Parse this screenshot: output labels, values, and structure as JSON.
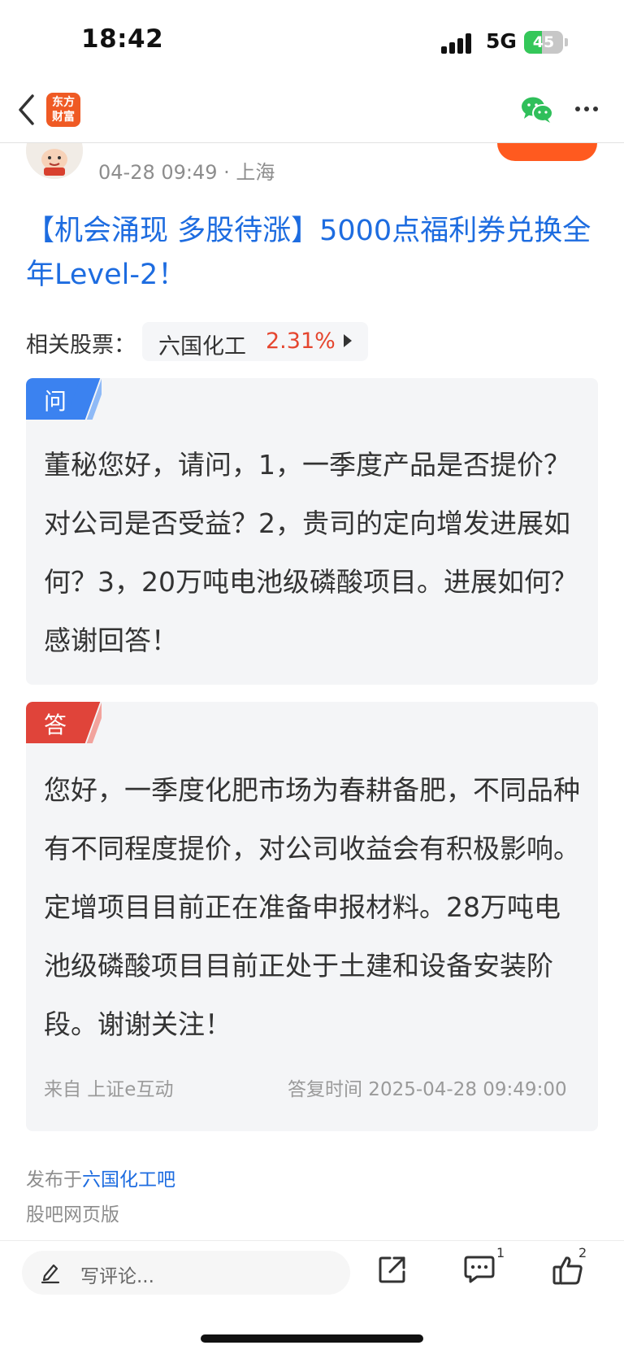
{
  "status_bar": {
    "time": "18:42",
    "network": "5G",
    "battery": "45",
    "battery_level": 0.45
  },
  "nav": {
    "logo_line1": "东方",
    "logo_line2": "财富"
  },
  "author": {
    "date": "04-28 09:49",
    "location": "· 上海"
  },
  "post": {
    "title": "【机会涌现 多股待涨】5000点福利券兑换全年Level-2！"
  },
  "related": {
    "label": "相关股票：",
    "stock_name": "六国化工",
    "stock_change": "2.31%",
    "accent_up": "#e5462f"
  },
  "question": {
    "tag": "问",
    "text": "董秘您好，请问，1，一季度产品是否提价？对公司是否受益？2，贵司的定向增发进展如何？3，20万吨电池级磷酸项目。进展如何？感谢回答！"
  },
  "answer": {
    "tag": "答",
    "text": "您好，一季度化肥市场为春耕备肥，不同品种有不同程度提价，对公司收益会有积极影响。定增项目目前正在准备申报材料。28万吨电池级磷酸项目目前正处于土建和设备安装阶段。谢谢关注！",
    "source": "来自 上证e互动",
    "reply_time": "答复时间 2025-04-28 09:49:00"
  },
  "footer": {
    "published_prefix": "发布于",
    "bar_name": "六国化工吧",
    "web_version": "股吧网页版"
  },
  "bottom_bar": {
    "comment_placeholder": "写评论...",
    "comment_count": "1",
    "like_count": "2"
  },
  "colors": {
    "link_blue": "#1d6ce0",
    "brand_orange": "#ef5a24",
    "follow_orange": "#ff5a1f",
    "question_blue": "#3b82f0",
    "answer_red": "#e0443a"
  },
  "icons": [
    "back-arrow-icon",
    "eastmoney-logo",
    "wechat-icon",
    "more-icon",
    "pencil-icon",
    "share-icon",
    "comment-icon",
    "thumbs-up-icon"
  ]
}
